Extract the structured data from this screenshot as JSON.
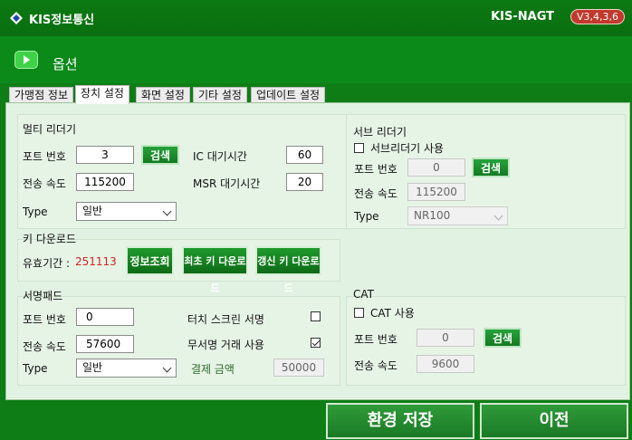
{
  "titlebar": {
    "brand": "KIS정보통신",
    "app_name": "KIS-NAGT",
    "version": "V3,4,3,6"
  },
  "header": {
    "title": "옵션"
  },
  "tabs": [
    "가맹점 정보",
    "장치 설정",
    "화면 설정",
    "기타 설정",
    "업데이트 설정"
  ],
  "multi_reader": {
    "title": "멀티 리더기",
    "port_label": "포트 번호",
    "port_value": "3",
    "search_label": "검색",
    "speed_label": "전송 속도",
    "speed_value": "115200",
    "type_label": "Type",
    "type_value": "일반",
    "ic_wait_label": "IC 대기시간",
    "ic_wait_value": "60",
    "msr_wait_label": "MSR 대기시간",
    "msr_wait_value": "20"
  },
  "sub_reader": {
    "title": "서브 리더기",
    "use_label": "서브리더기 사용",
    "port_label": "포트 번호",
    "port_value": "0",
    "search_label": "검색",
    "speed_label": "전송 속도",
    "speed_value": "115200",
    "type_label": "Type",
    "type_value": "NR100"
  },
  "key_download": {
    "title": "키 다운로드",
    "valid_label": "유효기간 :",
    "valid_value": "251113",
    "info_button": "정보조회",
    "first_button": "최초 키 다운로드",
    "renew_button": "갱신 키 다운로드"
  },
  "signpad": {
    "title": "서명패드",
    "port_label": "포트 번호",
    "port_value": "0",
    "speed_label": "전송 속도",
    "speed_value": "57600",
    "type_label": "Type",
    "type_value": "일반",
    "touch_label": "터치 스크린 서명",
    "nosign_label": "무서명 거래 사용",
    "amount_label": "결제 금액",
    "amount_value": "50000"
  },
  "cat": {
    "title": "CAT",
    "use_label": "CAT 사용",
    "port_label": "포트 번호",
    "port_value": "0",
    "search_label": "검색",
    "speed_label": "전송 속도",
    "speed_value": "9600"
  },
  "footer": {
    "save_label": "환경 저장",
    "close_label": "이전"
  }
}
